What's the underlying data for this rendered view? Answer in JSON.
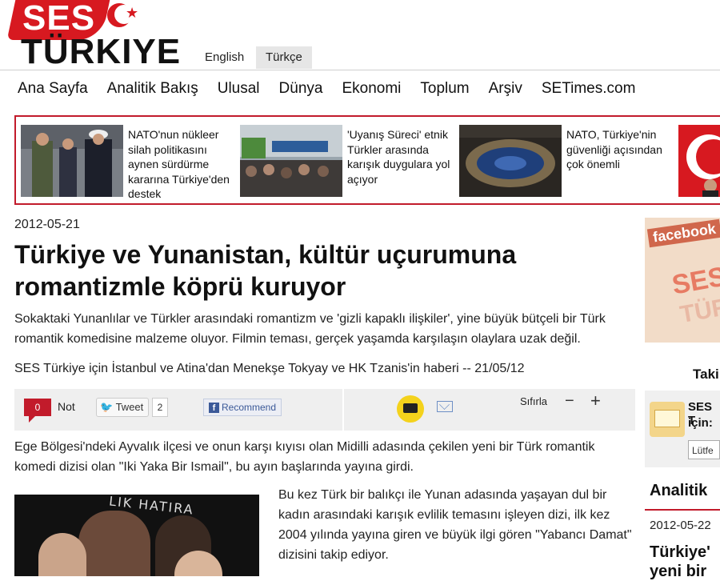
{
  "logo": {
    "line1": "SES",
    "line2": "TÜRKIYE"
  },
  "languages": {
    "english": "English",
    "turkish": "Türkçe"
  },
  "nav": [
    "Ana Sayfa",
    "Analitik Bakış",
    "Ulusal",
    "Dünya",
    "Ekonomi",
    "Toplum",
    "Arşiv",
    "SETimes.com"
  ],
  "news_strip": [
    {
      "caption": "NATO'nun nükleer silah politikasını aynen sürdürme kararına Türkiye'den destek"
    },
    {
      "caption": "'Uyanış Süreci' etnik Türkler arasında karışık duygulara yol açıyor"
    },
    {
      "caption": "NATO, Türkiye'nin güvenliği açısından çok önemli"
    }
  ],
  "article": {
    "date": "2012-05-21",
    "title": "Türkiye ve Yunanistan, kültür uçurumuna romantizmle köprü kuruyor",
    "lead": "Sokaktaki Yunanlılar ve Türkler arasındaki romantizm ve 'gizli kapaklı ilişkiler', yine büyük bütçeli bir Türk romantik komedisine malzeme oluyor. Filmin teması, gerçek yaşamda karşılaşın olaylara uzak değil.",
    "byline": "SES Türkiye için İstanbul ve Atina'dan Menekşe Tokyay ve HK Tzanis'in haberi -- 21/05/12",
    "para1": "Ege Bölgesi'ndeki Ayvalık ilçesi ve onun karşı kıyısı olan Midilli adasında çekilen yeni bir Türk romantik komedi dizisi olan \"Iki Yaka Bir Ismail\", bu ayın başlarında yayına girdi.",
    "para2": "Bu kez Türk bir balıkçı ile Yunan adasında yaşayan dul bir kadın arasındaki karışık evlilik temasını işleyen dizi, ilk kez 2004 yılında yayına giren ve büyük ilgi gören \"Yabancı Damat\" dizisini takip ediyor.",
    "photo_text": "LIK HATIRA"
  },
  "tools": {
    "not_count": "0",
    "not_label": "Not",
    "tweet_label": "Tweet",
    "tweet_count": "2",
    "recommend_label": "Recommend",
    "sifirla": "Sıfırla",
    "minus": "−",
    "plus": "+"
  },
  "sidebar": {
    "facebook": "facebook",
    "fb_ses": "SES",
    "fb_tur": "TÜR",
    "taki": "Taki",
    "sub_ses": "SES T",
    "sub_icin": "için:",
    "sub_input": "Lütfe",
    "analitik": "Analitik",
    "date": "2012-05-22",
    "title": "Türkiye' yeni bir"
  },
  "colors": {
    "brand_red": "#d71920",
    "border_red": "#c21b2b"
  }
}
